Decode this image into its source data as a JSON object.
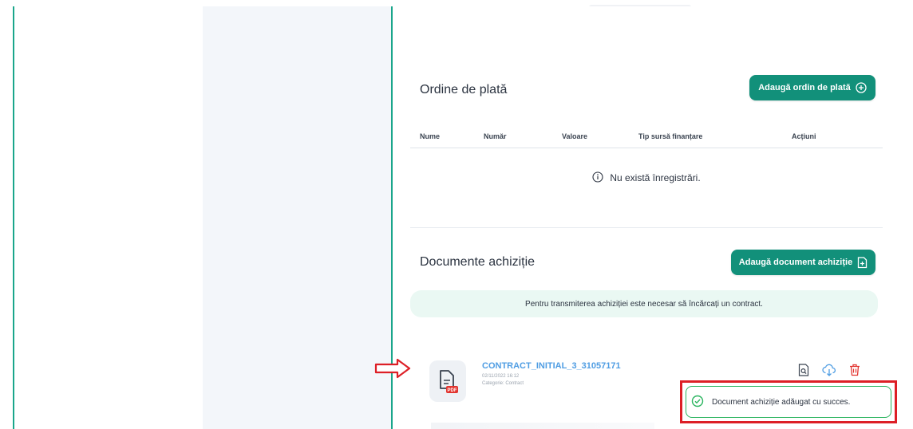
{
  "payment_orders": {
    "title": "Ordine de plată",
    "add_button_label": "Adaugă ordin de plată",
    "columns": [
      "Nume",
      "Număr",
      "Valoare",
      "Tip sursă finanțare",
      "Acțiuni"
    ],
    "empty_message": "Nu există înregistrări."
  },
  "documents": {
    "title": "Documente achiziție",
    "add_button_label": "Adaugă document achiziție",
    "notice": "Pentru transmiterea achiziției este necesar să încărcați un contract.",
    "items": [
      {
        "name": "CONTRACT_INITIAL_3_31057171",
        "date": "02/11/2022 16:12",
        "category": "Categorie: Contract",
        "badge": "PDF",
        "icon": "pdf-file-icon"
      }
    ]
  },
  "toast": {
    "message": "Document achiziție adăugat cu succes.",
    "icon": "check-circle-icon"
  },
  "colors": {
    "accent": "#12907a",
    "divider": "#1aa68b",
    "link": "#4f9de3",
    "danger": "#dd1f26",
    "success": "#2ab45f",
    "notice_bg": "#eaf8f3"
  }
}
